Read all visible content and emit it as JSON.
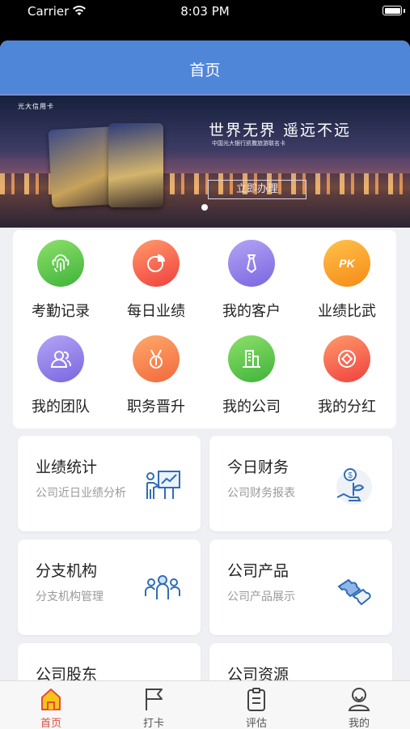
{
  "status_bar": {
    "carrier": "Carrier",
    "time": "8:03 PM"
  },
  "nav": {
    "title": "首页"
  },
  "banner": {
    "slogan": "世界无界 遥远不远",
    "subtitle": "中国光大银行凯撒旅游联名卡",
    "cta": "立即办理",
    "logo_text": "光大信用卡"
  },
  "grid": {
    "items": [
      {
        "label": "考勤记录",
        "icon": "fingerprint-icon",
        "color": "#5cc040"
      },
      {
        "label": "每日业绩",
        "icon": "pie-chart-icon",
        "color": "#f05b41"
      },
      {
        "label": "我的客户",
        "icon": "tie-icon",
        "color": "#8d7ae8"
      },
      {
        "label": "业绩比武",
        "icon": "pk-icon",
        "color": "#f7911e"
      },
      {
        "label": "我的团队",
        "icon": "team-icon",
        "color": "#8d7ae8"
      },
      {
        "label": "职务晋升",
        "icon": "medal-icon",
        "color": "#f7911e"
      },
      {
        "label": "我的公司",
        "icon": "building-icon",
        "color": "#5cc040"
      },
      {
        "label": "我的分红",
        "icon": "dividend-icon",
        "color": "#f05b41"
      }
    ]
  },
  "cards": [
    {
      "title": "业绩统计",
      "subtitle": "公司近日业绩分析",
      "icon": "presentation-icon"
    },
    {
      "title": "今日财务",
      "subtitle": "公司财务报表",
      "icon": "money-plant-icon"
    },
    {
      "title": "分支机构",
      "subtitle": "分支机构管理",
      "icon": "group-icon"
    },
    {
      "title": "公司产品",
      "subtitle": "公司产品展示",
      "icon": "puzzle-icon"
    },
    {
      "title": "公司股东",
      "subtitle": "",
      "icon": "shareholder-icon"
    },
    {
      "title": "公司资源",
      "subtitle": "",
      "icon": "resource-icon"
    }
  ],
  "tabs": [
    {
      "label": "首页",
      "icon": "home-icon",
      "active": true
    },
    {
      "label": "打卡",
      "icon": "flag-icon",
      "active": false
    },
    {
      "label": "评估",
      "icon": "clipboard-icon",
      "active": false
    },
    {
      "label": "我的",
      "icon": "user-icon",
      "active": false
    }
  ],
  "colors": {
    "nav": "#4f86d8",
    "active_tab": "#e24b3b",
    "icon_blue": "#2f6db5"
  }
}
